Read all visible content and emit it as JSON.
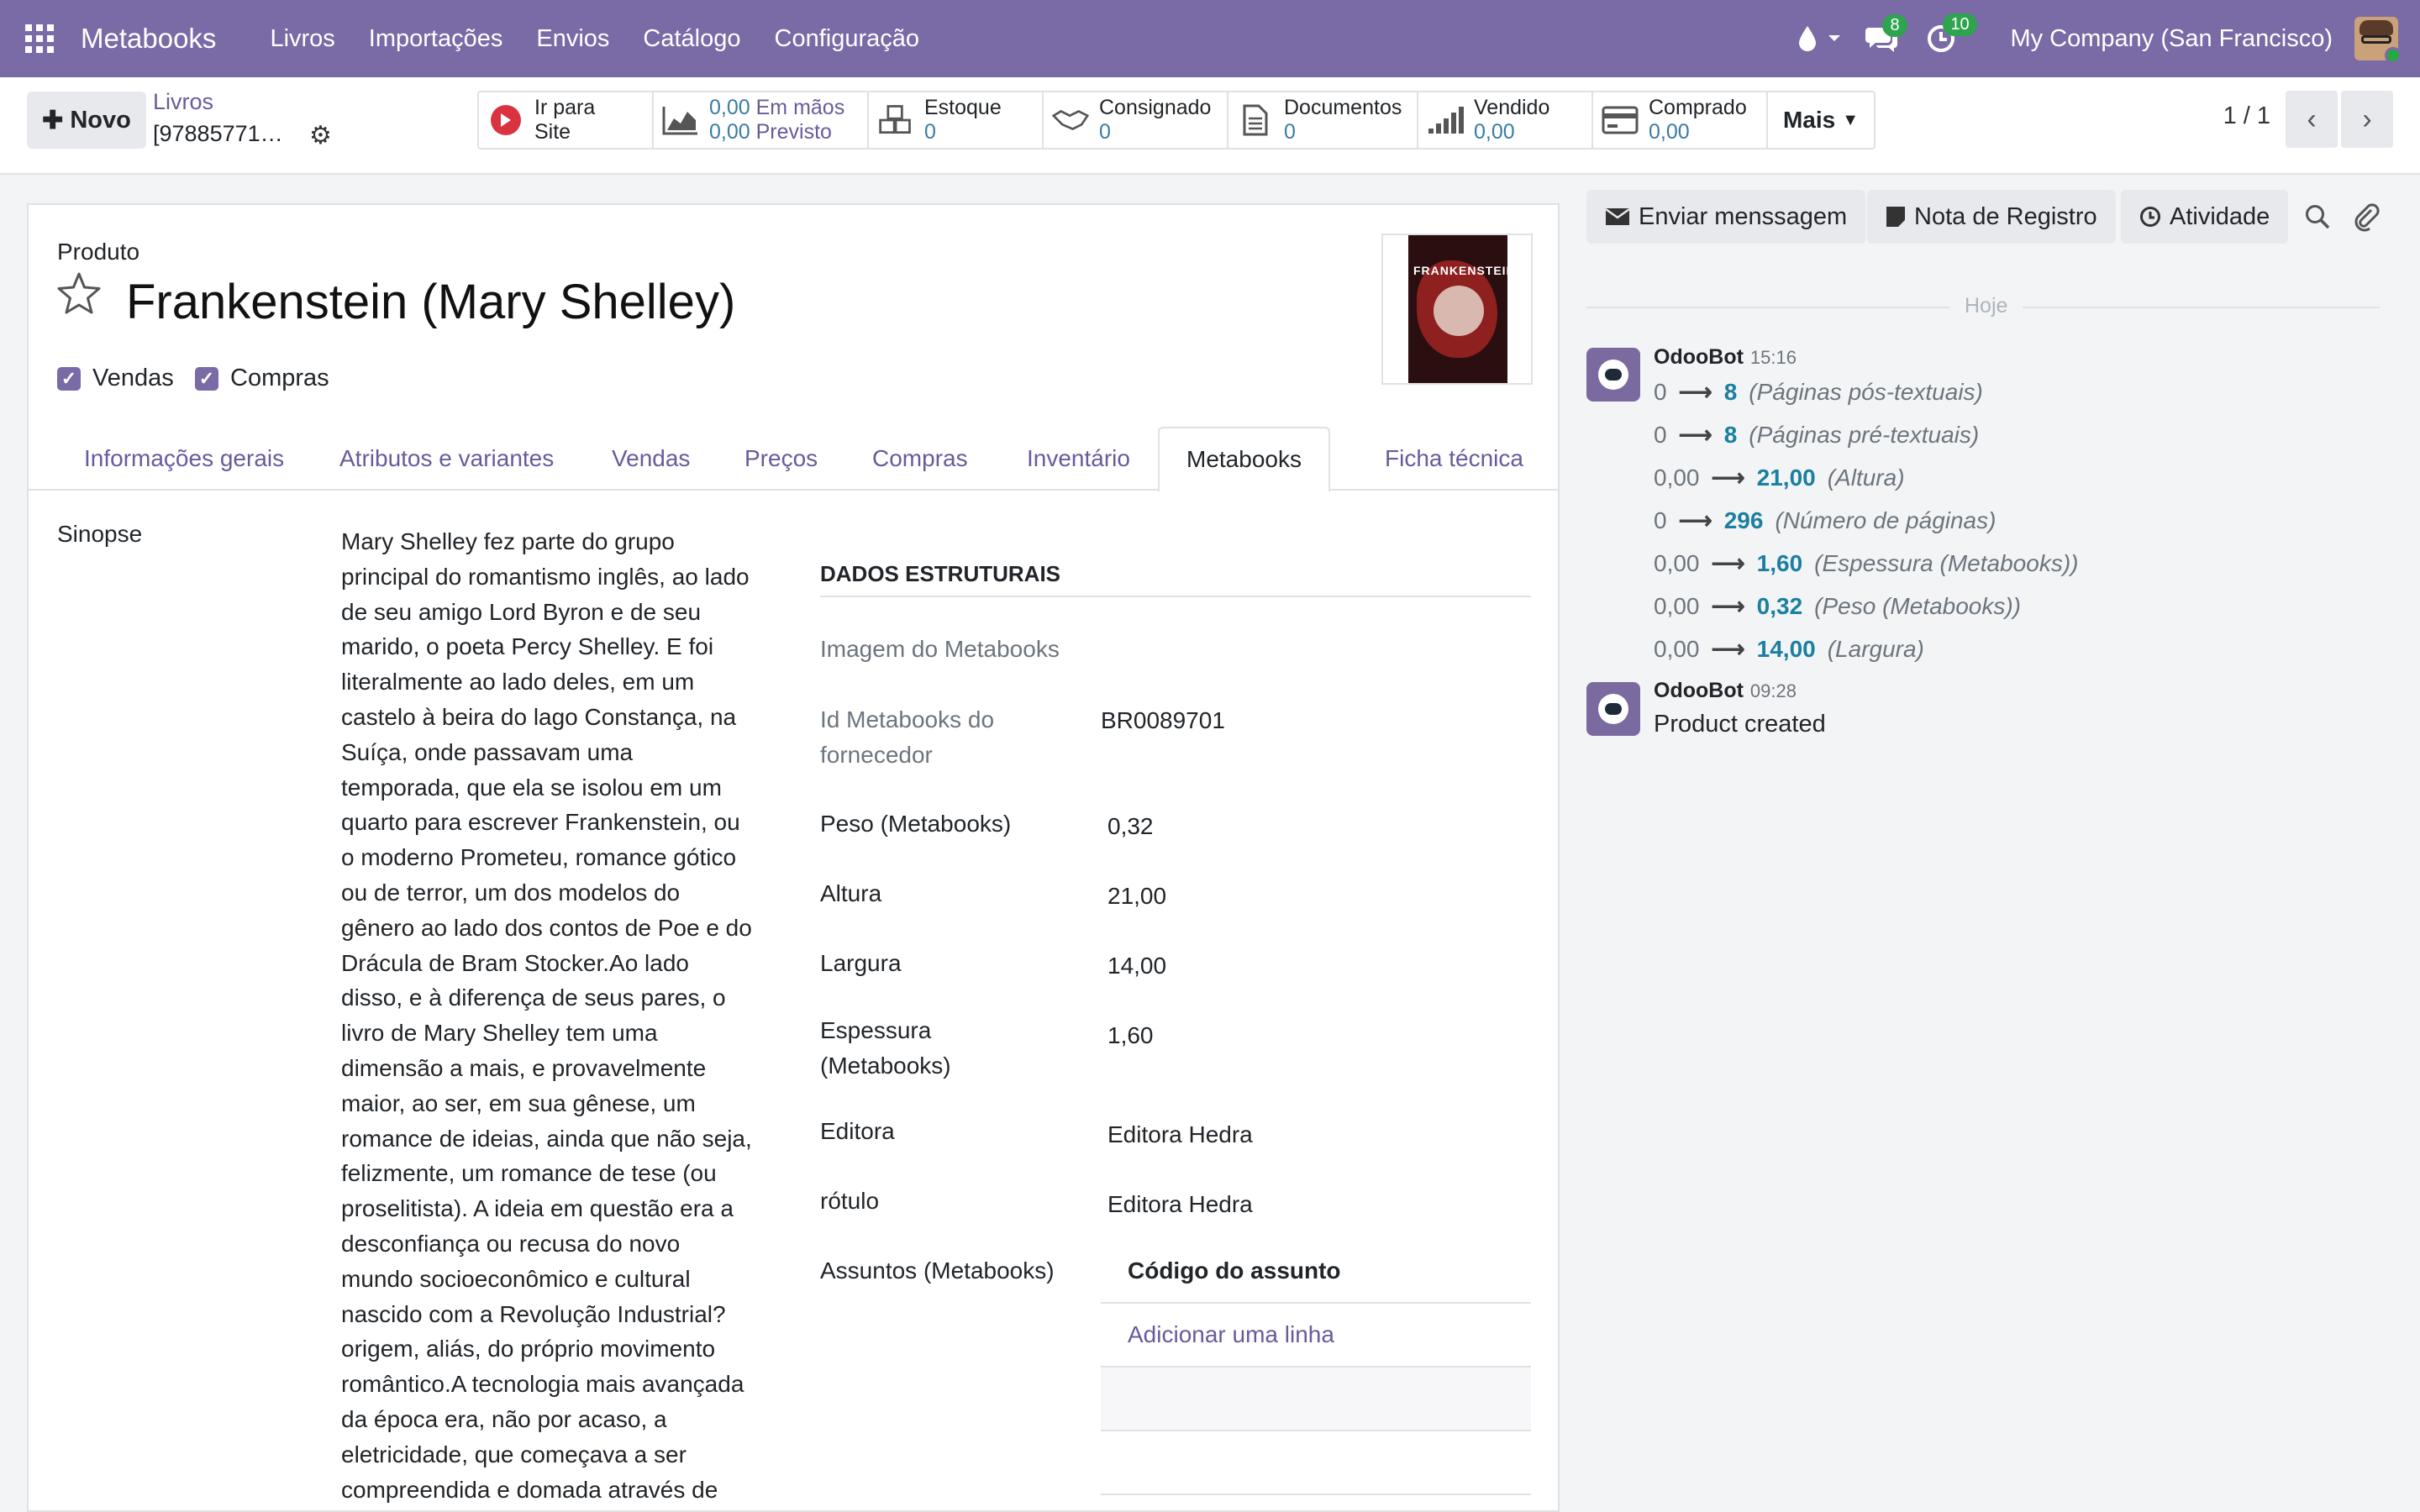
{
  "navbar": {
    "brand": "Metabooks",
    "menu": [
      "Livros",
      "Importações",
      "Envios",
      "Catálogo",
      "Configuração"
    ],
    "messages_badge": "8",
    "activities_badge": "10",
    "company": "My Company (San Francisco)",
    "accent": "#7a6aa6"
  },
  "control": {
    "new_label": "Novo",
    "breadcrumb_parent": "Livros",
    "breadcrumb_current": "[97885771…",
    "smart_buttons": {
      "site": {
        "line1": "Ir para",
        "line2": "Site"
      },
      "stock_forecast": {
        "on_hand_value": "0,00",
        "on_hand_label": "Em mãos",
        "forecast_value": "0,00",
        "forecast_label": "Previsto"
      },
      "estoque": {
        "label": "Estoque",
        "value": "0"
      },
      "consignado": {
        "label": "Consignado",
        "value": "0"
      },
      "documentos": {
        "label": "Documentos",
        "value": "0"
      },
      "vendido": {
        "label": "Vendido",
        "value": "0,00"
      },
      "comprado": {
        "label": "Comprado",
        "value": "0,00"
      },
      "mais": "Mais"
    },
    "pager": "1 / 1"
  },
  "form": {
    "product_type_label": "Produto",
    "title": "Frankenstein (Mary Shelley)",
    "checkbox_sales": "Vendas",
    "checkbox_purchase": "Compras",
    "tabs": [
      "Informações gerais",
      "Atributos e variantes",
      "Vendas",
      "Preços",
      "Compras",
      "Inventário",
      "Metabooks",
      "Ficha técnica"
    ],
    "active_tab": "Metabooks",
    "sinopse_label": "Sinopse",
    "sinopse_lines": [
      "Mary Shelley fez parte do grupo",
      "principal do romantismo inglês, ao lado",
      "de seu amigo Lord Byron e de seu",
      "marido, o poeta Percy Shelley. E foi",
      "literalmente ao lado deles, em um",
      "castelo à beira do lago Constança, na",
      "Suíça, onde passavam uma",
      "temporada, que ela se isolou em um",
      "quarto para escrever Frankenstein, ou",
      "o moderno Prometeu, romance gótico",
      "ou de terror, um dos modelos do",
      "gênero ao lado dos contos de Poe e do",
      "Drácula de Bram Stocker.Ao lado",
      "disso, e à diferença de seus pares, o",
      "livro de Mary Shelley tem uma",
      "dimensão a mais, e provavelmente",
      "maior, ao ser, em sua gênese, um",
      "romance de ideias, ainda que não seja,",
      "felizmente, um romance de tese (ou",
      "proselitista). A ideia em questão era a",
      "desconfiança ou recusa do novo",
      "mundo socioeconômico e cultural",
      "nascido com a Revolução Industrial?",
      "origem, aliás, do próprio movimento",
      "romântico.A tecnologia mais avançada",
      "da época era, não por acaso, a",
      "eletricidade, que começava a ser",
      "compreendida e domada através de"
    ],
    "section_title": "DADOS ESTRUTURAIS",
    "image_label": "Imagem do Metabooks",
    "supplier_id_label_1": "Id Metabooks do",
    "supplier_id_label_2": "fornecedor",
    "supplier_id_value": "BR0089701",
    "peso_label": "Peso (Metabooks)",
    "peso_value": "0,32",
    "altura_label": "Altura",
    "altura_value": "21,00",
    "largura_label": "Largura",
    "largura_value": "14,00",
    "espessura_label_1": "Espessura",
    "espessura_label_2": "(Metabooks)",
    "espessura_value": "1,60",
    "editora_label": "Editora",
    "editora_value": "Editora Hedra",
    "rotulo_label": "rótulo",
    "rotulo_value": "Editora Hedra",
    "assuntos_label": "Assuntos (Metabooks)",
    "assuntos_col": "Código do assunto",
    "assuntos_add": "Adicionar uma linha",
    "cover_title": "FRANKENSTEIN"
  },
  "chatter": {
    "send_message": "Enviar menssagem",
    "log_note": "Nota de Registro",
    "activity": "Atividade",
    "day_separator": "Hoje",
    "messages": [
      {
        "author": "OdooBot",
        "time": "15:16",
        "tracking": [
          {
            "old": "0",
            "new": "8",
            "field": "(Páginas pós-textuais)"
          },
          {
            "old": "0",
            "new": "8",
            "field": "(Páginas pré-textuais)"
          },
          {
            "old": "0,00",
            "new": "21,00",
            "field": "(Altura)"
          },
          {
            "old": "0",
            "new": "296",
            "field": "(Número de páginas)"
          },
          {
            "old": "0,00",
            "new": "1,60",
            "field": "(Espessura (Metabooks))"
          },
          {
            "old": "0,00",
            "new": "0,32",
            "field": "(Peso (Metabooks))"
          },
          {
            "old": "0,00",
            "new": "14,00",
            "field": "(Largura)"
          }
        ]
      },
      {
        "author": "OdooBot",
        "time": "09:28",
        "body": "Product created"
      }
    ]
  }
}
